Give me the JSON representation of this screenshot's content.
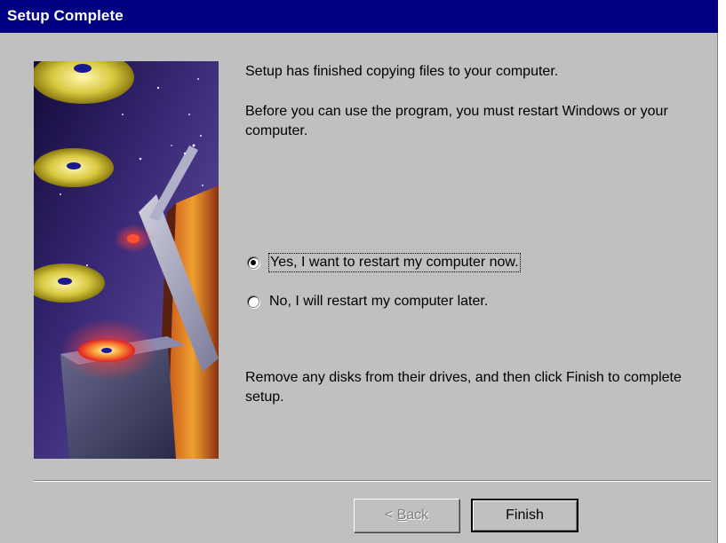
{
  "window": {
    "title": "Setup Complete"
  },
  "content": {
    "message_1": "Setup has finished copying files to your computer.",
    "message_2": "Before you can use the program, you must restart Windows or your computer.",
    "message_3": "Remove any disks from their drives, and then click Finish to complete setup."
  },
  "options": {
    "restart_now": {
      "label": "Yes, I want to restart my computer now.",
      "selected": true
    },
    "restart_later": {
      "label": "No, I will restart my computer later.",
      "selected": false
    }
  },
  "buttons": {
    "back_prefix": "< ",
    "back_accel": "B",
    "back_rest": "ack",
    "back_enabled": false,
    "finish_label": "Finish"
  },
  "colors": {
    "title_bar": "#000080",
    "dialog_face": "#c0c0c0",
    "disabled_text": "#808080"
  }
}
